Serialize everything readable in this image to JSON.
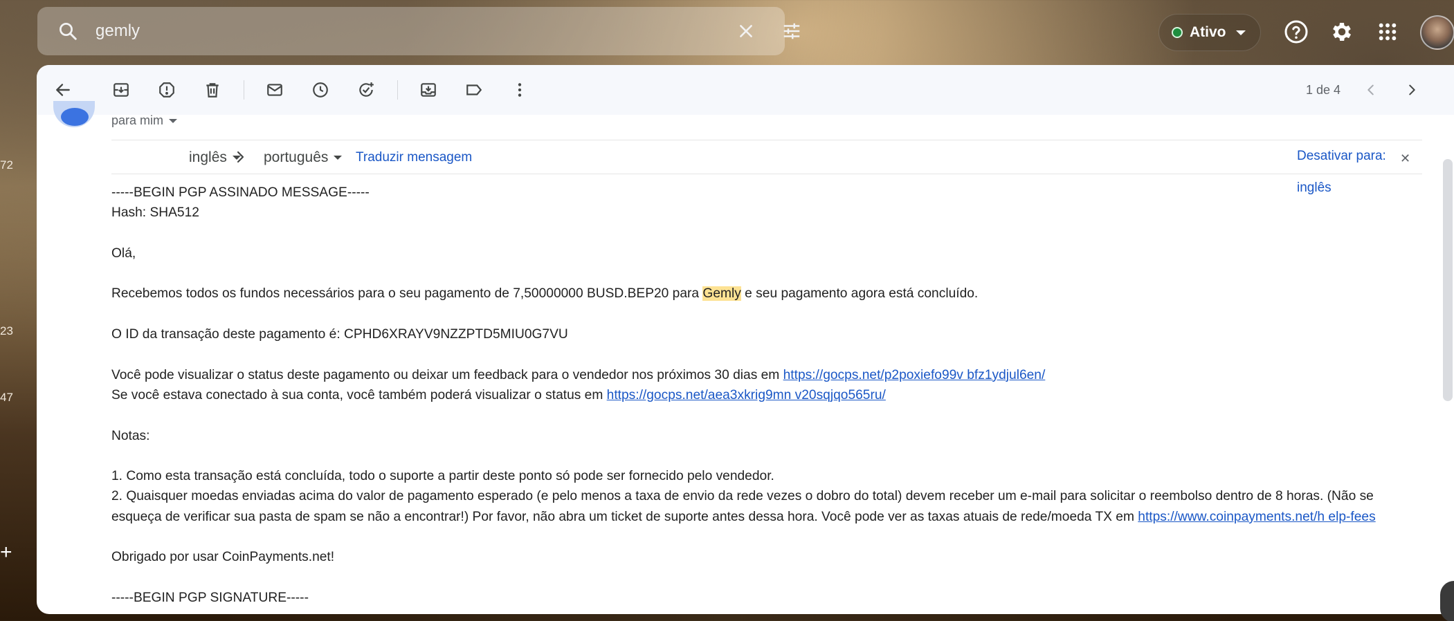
{
  "search": {
    "query": "gemly"
  },
  "status": {
    "label": "Ativo",
    "color": "#1e8e3e"
  },
  "left_strip": {
    "numbers": [
      "72",
      "23",
      "47"
    ]
  },
  "toolbar": {
    "pager": "1 de 4"
  },
  "message": {
    "to_label": "para mim",
    "translate": {
      "from_lang": "inglês",
      "to_lang": "português",
      "translate_link": "Traduzir mensagem",
      "disable_link": "Desativar para: inglês"
    },
    "lines": {
      "l1": "-----BEGIN PGP ASSINADO MESSAGE-----",
      "l2": "Hash: SHA512",
      "l3": "Olá,",
      "l4_pre": "Recebemos todos os fundos necessários para o seu pagamento de 7,50000000 BUSD.BEP20 para ",
      "l4_hl": "Gemly",
      "l4_post": " e seu pagamento agora está concluído.",
      "l5": "O ID da transação deste pagamento é: CPHD6XRAYV9NZZPTD5MIU0G7VU",
      "l6_pre": "Você pode visualizar o status deste pagamento ou deixar um feedback para o vendedor nos próximos 30 dias em ",
      "l6_link": "https://gocps.net/p2poxiefo99v bfz1ydjul6en/",
      "l7_pre": "Se você estava conectado à sua conta, você também poderá visualizar o status em ",
      "l7_link": "https://gocps.net/aea3xkrig9mn v20sqjqo565ru/",
      "l8": "Notas:",
      "l9": "1. Como esta transação está concluída, todo o suporte a partir deste ponto só pode ser fornecido pelo vendedor.",
      "l10_pre": "2. Quaisquer moedas enviadas acima do valor de pagamento esperado (e pelo menos a taxa de envio da rede vezes o dobro do total) devem receber um e-mail para solicitar o reembolso dentro de 8 horas. (Não se esqueça de verificar sua pasta de spam se não a encontrar!) Por favor, não abra um ticket de suporte antes dessa hora. Você pode ver as taxas atuais de rede/moeda TX em ",
      "l10_link": "https://www.coinpayments.net/h elp-fees",
      "l11": "Obrigado por usar CoinPayments.net!",
      "l12": "-----BEGIN PGP SIGNATURE-----"
    }
  }
}
